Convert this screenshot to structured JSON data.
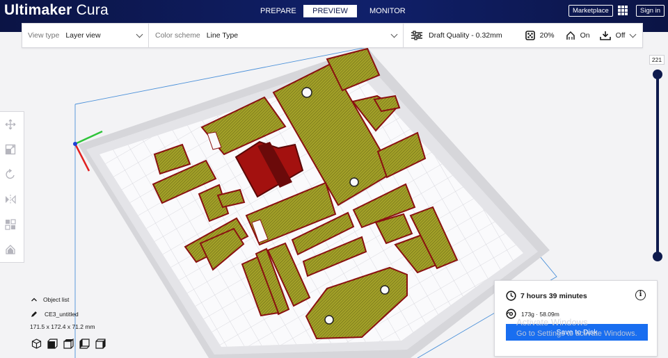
{
  "app": {
    "brand_bold": "Ultimaker",
    "brand_thin": "Cura"
  },
  "header": {
    "tabs": [
      {
        "label": "PREPARE",
        "active": false
      },
      {
        "label": "PREVIEW",
        "active": true
      },
      {
        "label": "MONITOR",
        "active": false
      }
    ],
    "marketplace_label": "Marketplace",
    "apps_icon": "grid-icon",
    "signin_label": "Sign in",
    "colors": {
      "header_bg": "#0e1a4d",
      "accent": "#196ef0"
    }
  },
  "toolbar": {
    "view_type_label": "View type",
    "view_type_value": "Layer view",
    "color_scheme_label": "Color scheme",
    "color_scheme_value": "Line Type",
    "quality_icon": "sliders-icon",
    "quality_value": "Draft Quality - 0.32mm",
    "infill_icon": "infill-icon",
    "infill_value": "20%",
    "support_icon": "support-icon",
    "support_value": "On",
    "adhesion_icon": "adhesion-icon",
    "adhesion_value": "Off"
  },
  "left_tools": [
    {
      "name": "move-icon"
    },
    {
      "name": "scale-icon"
    },
    {
      "name": "rotate-icon"
    },
    {
      "name": "mirror-icon"
    },
    {
      "name": "per-model-settings-icon"
    },
    {
      "name": "support-blocker-icon"
    }
  ],
  "layer_slider": {
    "current_layer": "221",
    "level_fraction": 1.0
  },
  "object_list": {
    "title": "Object list",
    "object_name": "CE3_untitled",
    "dimensions": "171.5 x 172.4 x 71.2 mm",
    "view_buttons": [
      "3d-view-icon",
      "front-view-icon",
      "top-view-icon",
      "left-view-icon",
      "right-view-icon"
    ]
  },
  "print_panel": {
    "time": "7 hours 39 minutes",
    "material": "173g · 58.09m",
    "save_label": "Save to Disk",
    "info_glyph": "i"
  },
  "watermark": {
    "line1": "Activate Windows",
    "line2": "Go to Settings to activate Windows."
  }
}
